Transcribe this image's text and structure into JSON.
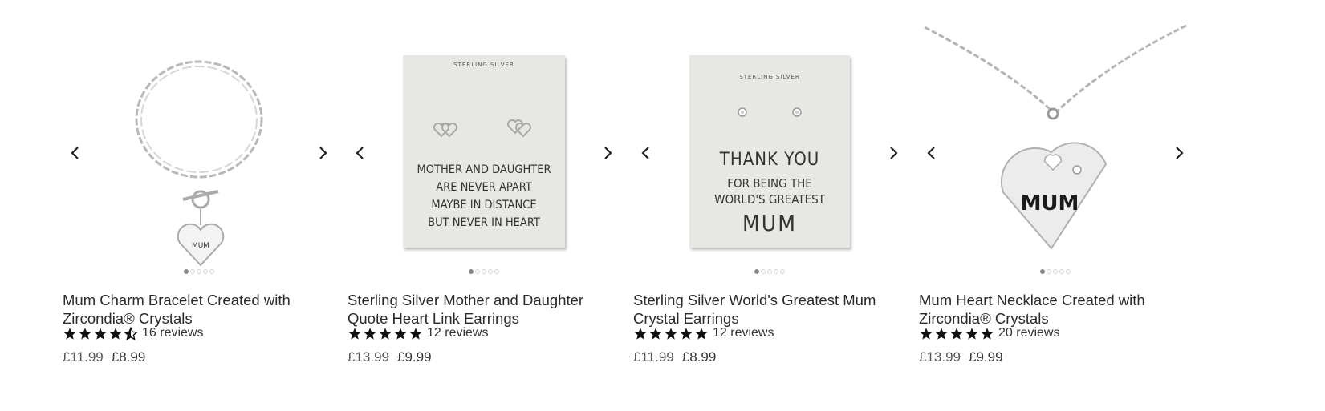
{
  "products": [
    {
      "title": "Mum Charm Bracelet Created with Zircondia® Crystals",
      "rating": 4.5,
      "reviews": "16 reviews",
      "old_price": "£11.99",
      "price": "£8.99",
      "image_icon": "bracelet-icon",
      "charm_text": "MUM",
      "slides": 5,
      "active_slide": 1
    },
    {
      "title": "Sterling Silver Mother and Daughter Quote Heart Link Earrings",
      "rating": 5,
      "reviews": "12 reviews",
      "old_price": "£13.99",
      "price": "£9.99",
      "image_icon": "heart-earrings-card-icon",
      "card_header": "STERLING SILVER",
      "card_lines": [
        "MOTHER AND DAUGHTER",
        "ARE NEVER APART",
        "MAYBE IN DISTANCE",
        "BUT NEVER IN HEART"
      ],
      "slides": 5,
      "active_slide": 1
    },
    {
      "title": "Sterling Silver World's Greatest Mum Crystal Earrings",
      "rating": 5,
      "reviews": "12 reviews",
      "old_price": "£11.99",
      "price": "£8.99",
      "image_icon": "crystal-earrings-card-icon",
      "card_header": "STERLING SILVER",
      "card_lines": [
        "THANK YOU",
        "FOR BEING THE",
        "WORLD'S GREATEST",
        "MUM"
      ],
      "slides": 5,
      "active_slide": 1
    },
    {
      "title": "Mum Heart Necklace Created with Zircondia® Crystals",
      "rating": 5,
      "reviews": "20 reviews",
      "old_price": "£13.99",
      "price": "£9.99",
      "image_icon": "heart-necklace-icon",
      "pendant_text": "MUM",
      "slides": 5,
      "active_slide": 1
    }
  ]
}
